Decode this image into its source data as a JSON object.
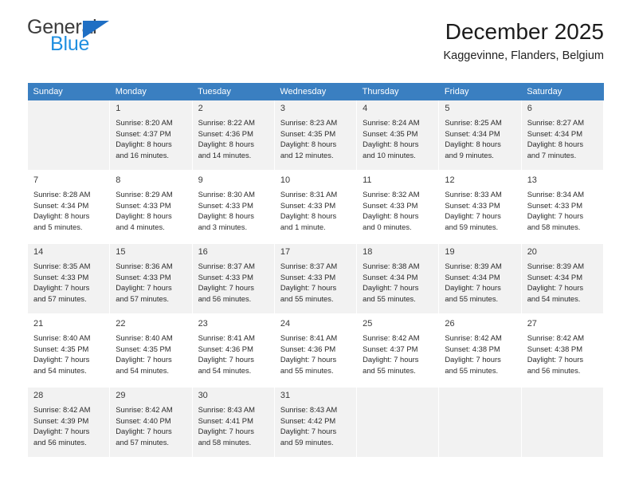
{
  "brand": {
    "name_part1": "General",
    "name_part2": "Blue",
    "logo_icon": "triangle-logo"
  },
  "header": {
    "title": "December 2025",
    "subtitle": "Kaggevinne, Flanders, Belgium"
  },
  "calendar": {
    "weekdays": [
      "Sunday",
      "Monday",
      "Tuesday",
      "Wednesday",
      "Thursday",
      "Friday",
      "Saturday"
    ],
    "accent_color": "#3a7fc1",
    "shaded_row_color": "#f2f2f2",
    "weeks": [
      [
        {
          "day": "",
          "sunrise": "",
          "sunset": "",
          "daylight1": "",
          "daylight2": ""
        },
        {
          "day": "1",
          "sunrise": "Sunrise: 8:20 AM",
          "sunset": "Sunset: 4:37 PM",
          "daylight1": "Daylight: 8 hours",
          "daylight2": "and 16 minutes."
        },
        {
          "day": "2",
          "sunrise": "Sunrise: 8:22 AM",
          "sunset": "Sunset: 4:36 PM",
          "daylight1": "Daylight: 8 hours",
          "daylight2": "and 14 minutes."
        },
        {
          "day": "3",
          "sunrise": "Sunrise: 8:23 AM",
          "sunset": "Sunset: 4:35 PM",
          "daylight1": "Daylight: 8 hours",
          "daylight2": "and 12 minutes."
        },
        {
          "day": "4",
          "sunrise": "Sunrise: 8:24 AM",
          "sunset": "Sunset: 4:35 PM",
          "daylight1": "Daylight: 8 hours",
          "daylight2": "and 10 minutes."
        },
        {
          "day": "5",
          "sunrise": "Sunrise: 8:25 AM",
          "sunset": "Sunset: 4:34 PM",
          "daylight1": "Daylight: 8 hours",
          "daylight2": "and 9 minutes."
        },
        {
          "day": "6",
          "sunrise": "Sunrise: 8:27 AM",
          "sunset": "Sunset: 4:34 PM",
          "daylight1": "Daylight: 8 hours",
          "daylight2": "and 7 minutes."
        }
      ],
      [
        {
          "day": "7",
          "sunrise": "Sunrise: 8:28 AM",
          "sunset": "Sunset: 4:34 PM",
          "daylight1": "Daylight: 8 hours",
          "daylight2": "and 5 minutes."
        },
        {
          "day": "8",
          "sunrise": "Sunrise: 8:29 AM",
          "sunset": "Sunset: 4:33 PM",
          "daylight1": "Daylight: 8 hours",
          "daylight2": "and 4 minutes."
        },
        {
          "day": "9",
          "sunrise": "Sunrise: 8:30 AM",
          "sunset": "Sunset: 4:33 PM",
          "daylight1": "Daylight: 8 hours",
          "daylight2": "and 3 minutes."
        },
        {
          "day": "10",
          "sunrise": "Sunrise: 8:31 AM",
          "sunset": "Sunset: 4:33 PM",
          "daylight1": "Daylight: 8 hours",
          "daylight2": "and 1 minute."
        },
        {
          "day": "11",
          "sunrise": "Sunrise: 8:32 AM",
          "sunset": "Sunset: 4:33 PM",
          "daylight1": "Daylight: 8 hours",
          "daylight2": "and 0 minutes."
        },
        {
          "day": "12",
          "sunrise": "Sunrise: 8:33 AM",
          "sunset": "Sunset: 4:33 PM",
          "daylight1": "Daylight: 7 hours",
          "daylight2": "and 59 minutes."
        },
        {
          "day": "13",
          "sunrise": "Sunrise: 8:34 AM",
          "sunset": "Sunset: 4:33 PM",
          "daylight1": "Daylight: 7 hours",
          "daylight2": "and 58 minutes."
        }
      ],
      [
        {
          "day": "14",
          "sunrise": "Sunrise: 8:35 AM",
          "sunset": "Sunset: 4:33 PM",
          "daylight1": "Daylight: 7 hours",
          "daylight2": "and 57 minutes."
        },
        {
          "day": "15",
          "sunrise": "Sunrise: 8:36 AM",
          "sunset": "Sunset: 4:33 PM",
          "daylight1": "Daylight: 7 hours",
          "daylight2": "and 57 minutes."
        },
        {
          "day": "16",
          "sunrise": "Sunrise: 8:37 AM",
          "sunset": "Sunset: 4:33 PM",
          "daylight1": "Daylight: 7 hours",
          "daylight2": "and 56 minutes."
        },
        {
          "day": "17",
          "sunrise": "Sunrise: 8:37 AM",
          "sunset": "Sunset: 4:33 PM",
          "daylight1": "Daylight: 7 hours",
          "daylight2": "and 55 minutes."
        },
        {
          "day": "18",
          "sunrise": "Sunrise: 8:38 AM",
          "sunset": "Sunset: 4:34 PM",
          "daylight1": "Daylight: 7 hours",
          "daylight2": "and 55 minutes."
        },
        {
          "day": "19",
          "sunrise": "Sunrise: 8:39 AM",
          "sunset": "Sunset: 4:34 PM",
          "daylight1": "Daylight: 7 hours",
          "daylight2": "and 55 minutes."
        },
        {
          "day": "20",
          "sunrise": "Sunrise: 8:39 AM",
          "sunset": "Sunset: 4:34 PM",
          "daylight1": "Daylight: 7 hours",
          "daylight2": "and 54 minutes."
        }
      ],
      [
        {
          "day": "21",
          "sunrise": "Sunrise: 8:40 AM",
          "sunset": "Sunset: 4:35 PM",
          "daylight1": "Daylight: 7 hours",
          "daylight2": "and 54 minutes."
        },
        {
          "day": "22",
          "sunrise": "Sunrise: 8:40 AM",
          "sunset": "Sunset: 4:35 PM",
          "daylight1": "Daylight: 7 hours",
          "daylight2": "and 54 minutes."
        },
        {
          "day": "23",
          "sunrise": "Sunrise: 8:41 AM",
          "sunset": "Sunset: 4:36 PM",
          "daylight1": "Daylight: 7 hours",
          "daylight2": "and 54 minutes."
        },
        {
          "day": "24",
          "sunrise": "Sunrise: 8:41 AM",
          "sunset": "Sunset: 4:36 PM",
          "daylight1": "Daylight: 7 hours",
          "daylight2": "and 55 minutes."
        },
        {
          "day": "25",
          "sunrise": "Sunrise: 8:42 AM",
          "sunset": "Sunset: 4:37 PM",
          "daylight1": "Daylight: 7 hours",
          "daylight2": "and 55 minutes."
        },
        {
          "day": "26",
          "sunrise": "Sunrise: 8:42 AM",
          "sunset": "Sunset: 4:38 PM",
          "daylight1": "Daylight: 7 hours",
          "daylight2": "and 55 minutes."
        },
        {
          "day": "27",
          "sunrise": "Sunrise: 8:42 AM",
          "sunset": "Sunset: 4:38 PM",
          "daylight1": "Daylight: 7 hours",
          "daylight2": "and 56 minutes."
        }
      ],
      [
        {
          "day": "28",
          "sunrise": "Sunrise: 8:42 AM",
          "sunset": "Sunset: 4:39 PM",
          "daylight1": "Daylight: 7 hours",
          "daylight2": "and 56 minutes."
        },
        {
          "day": "29",
          "sunrise": "Sunrise: 8:42 AM",
          "sunset": "Sunset: 4:40 PM",
          "daylight1": "Daylight: 7 hours",
          "daylight2": "and 57 minutes."
        },
        {
          "day": "30",
          "sunrise": "Sunrise: 8:43 AM",
          "sunset": "Sunset: 4:41 PM",
          "daylight1": "Daylight: 7 hours",
          "daylight2": "and 58 minutes."
        },
        {
          "day": "31",
          "sunrise": "Sunrise: 8:43 AM",
          "sunset": "Sunset: 4:42 PM",
          "daylight1": "Daylight: 7 hours",
          "daylight2": "and 59 minutes."
        },
        {
          "day": "",
          "sunrise": "",
          "sunset": "",
          "daylight1": "",
          "daylight2": ""
        },
        {
          "day": "",
          "sunrise": "",
          "sunset": "",
          "daylight1": "",
          "daylight2": ""
        },
        {
          "day": "",
          "sunrise": "",
          "sunset": "",
          "daylight1": "",
          "daylight2": ""
        }
      ]
    ]
  }
}
